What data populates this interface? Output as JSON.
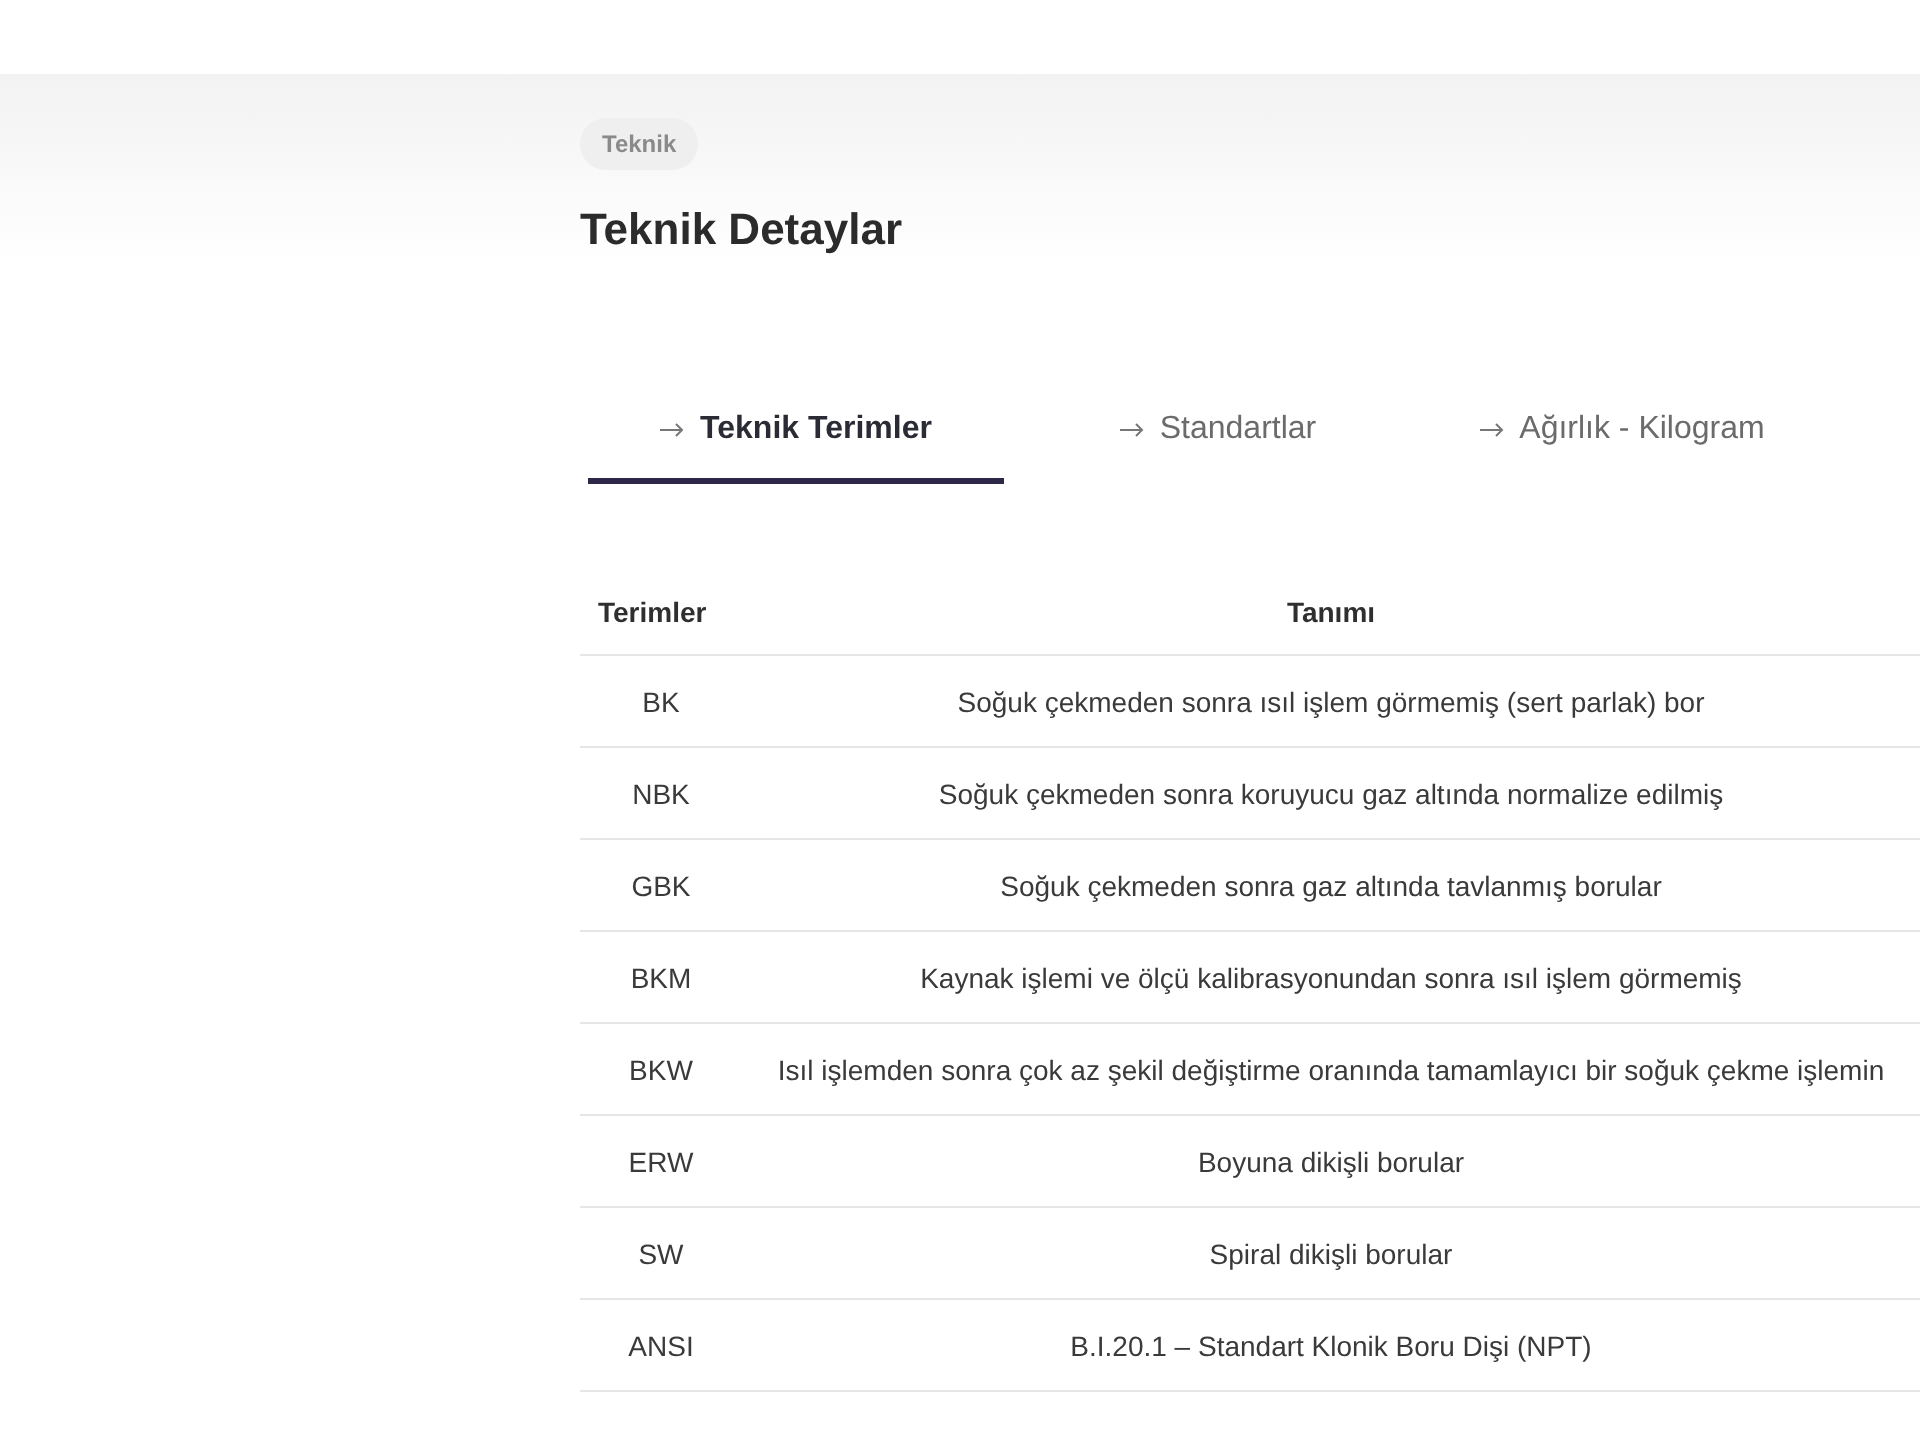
{
  "badge": "Teknik",
  "title": "Teknik Detaylar",
  "tabs": [
    {
      "label": "Teknik Terimler",
      "selected": true
    },
    {
      "label": "Standartlar",
      "selected": false
    },
    {
      "label": "Ağırlık - Kilogram",
      "selected": false
    }
  ],
  "table": {
    "columns": [
      "Terimler",
      "Tanımı"
    ],
    "rows": [
      [
        "BK",
        "Soğuk çekmeden sonra ısıl işlem görmemiş (sert parlak) bor"
      ],
      [
        "NBK",
        "Soğuk çekmeden sonra koruyucu gaz altında normalize edilmiş"
      ],
      [
        "GBK",
        "Soğuk çekmeden sonra gaz altında tavlanmış borular"
      ],
      [
        "BKM",
        "Kaynak işlemi ve ölçü kalibrasyonundan sonra ısıl işlem görmemiş"
      ],
      [
        "BKW",
        "Isıl işlemden sonra çok az şekil değiştirme oranında tamamlayıcı bir soğuk çekme işlemin"
      ],
      [
        "ERW",
        "Boyuna dikişli borular"
      ],
      [
        "SW",
        "Spiral dikişli borular"
      ],
      [
        "ANSI",
        "B.I.20.1 – Standart Klonik Boru Dişi (NPT)"
      ]
    ]
  }
}
